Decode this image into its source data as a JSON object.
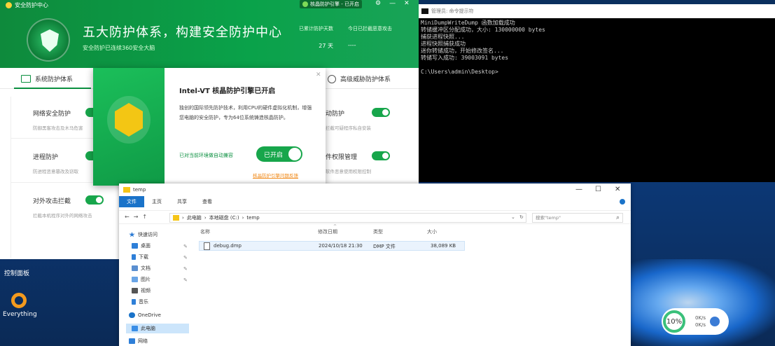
{
  "w360": {
    "title": "安全防护中心",
    "engine_badge": "核晶防护引擎 - 已开启",
    "slogan": "五大防护体系，构建安全防护中心",
    "sub": "安全防护已连续360安全大脑",
    "stat1_label": "已累计防护天数",
    "stat1_value": "27 天",
    "stat2_label": "今日已拦截恶意攻击",
    "stat2_value": "----",
    "tab1": "系统防护体系",
    "tab2": "高级威胁防护体系",
    "items": [
      {
        "name": "网络安全防护",
        "desc": "防御黑客攻击及木马危害"
      },
      {
        "name": "进程防护",
        "desc": "防进程恶意篡改及窃取"
      },
      {
        "name": "对外攻击拦截",
        "desc": "拦截本机程序对外的网络攻击"
      },
      {
        "name": "动防护",
        "desc": "拦截可疑程序私自安装"
      },
      {
        "name": "件权限管理",
        "desc": "软件恶意使用权限控制"
      }
    ]
  },
  "popup": {
    "title": "Intel-VT 核晶防护引擎已开启",
    "desc": "独创的国际领先防护技术，利用CPU的硬件虚拟化机制，增强您电脑的安全防护，专为64位系统铸造核晶防护。",
    "hint": "已对当前环境做自动兼容",
    "button": "已开启",
    "link": "核晶防护引擎问题反馈"
  },
  "cmd": {
    "title": "管理员: 命令提示符",
    "lines": [
      "MiniDumpWriteDump 函数加载成功",
      "转储缓冲区分配成功，大小: 130000000 bytes",
      "捕获进程快照...",
      "进程快照捕获成功",
      "迷你转储成功，开始修改签名...",
      "转储写入成功: 39003091 bytes",
      "",
      "C:\\Users\\admin\\Desktop>"
    ]
  },
  "explorer": {
    "title": "temp",
    "ribbon": [
      "文件",
      "主页",
      "共享",
      "查看"
    ],
    "path": [
      "此电脑",
      "本地磁盘 (C:)",
      "temp"
    ],
    "search_placeholder": "搜索\"temp\"",
    "nav": [
      "快速访问",
      "桌面",
      "下载",
      "文档",
      "图片",
      "视频",
      "音乐",
      "OneDrive",
      "此电脑",
      "网络"
    ],
    "columns": [
      "名称",
      "修改日期",
      "类型",
      "大小"
    ],
    "file": {
      "name": "debug.dmp",
      "date": "2024/10/18 21:30",
      "type": "DMP 文件",
      "size": "38,089 KB"
    }
  },
  "desktop": {
    "cp": "控制面板",
    "everything": "Everything",
    "speed_pct": "10%",
    "speed_up": "0K/s",
    "speed_down": "0K/s"
  }
}
